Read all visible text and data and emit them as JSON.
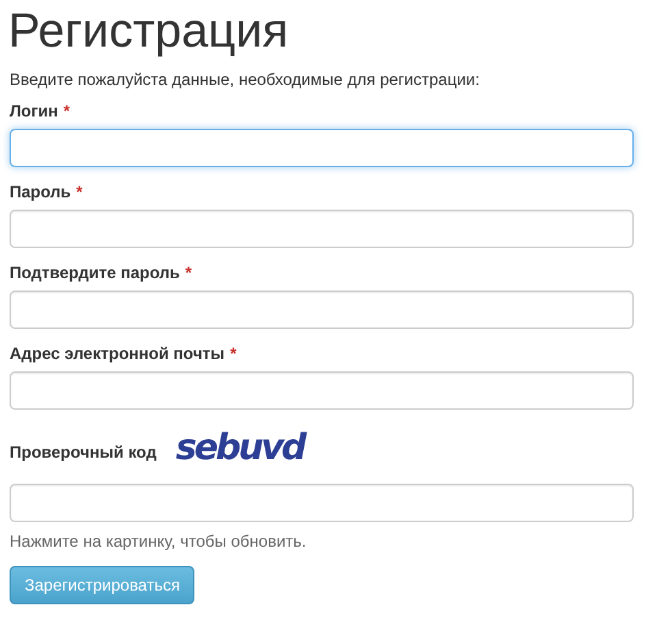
{
  "title": "Регистрация",
  "intro": "Введите пожалуйста данные, необходимые для регистрации:",
  "fields": [
    {
      "label": "Логин",
      "required_mark": "*",
      "focused": true
    },
    {
      "label": "Пароль",
      "required_mark": "*",
      "focused": false
    },
    {
      "label": "Подтвердите пароль",
      "required_mark": "*",
      "focused": false
    },
    {
      "label": "Адрес электронной почты",
      "required_mark": "*",
      "focused": false
    }
  ],
  "captcha": {
    "label": "Проверочный код",
    "code": "sebuvd",
    "hint": "Нажмите на картинку, чтобы обновить.",
    "focused": false
  },
  "submit_button": "Зарегистрироваться"
}
